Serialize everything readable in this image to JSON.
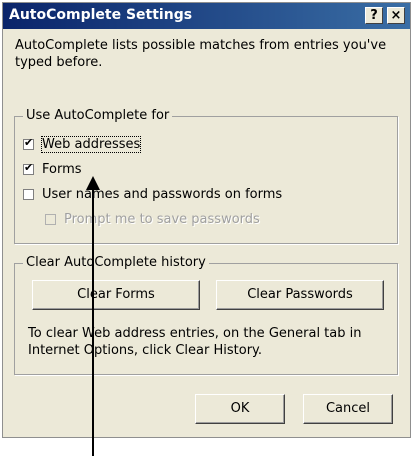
{
  "window": {
    "title": "AutoComplete Settings",
    "help_label": "?",
    "close_label": "×"
  },
  "description": "AutoComplete lists possible matches from entries you've typed before.",
  "use_group": {
    "label": "Use AutoComplete for",
    "options": [
      {
        "label": "Web addresses",
        "checked": true,
        "enabled": true
      },
      {
        "label": "Forms",
        "checked": true,
        "enabled": true
      },
      {
        "label": "User names and passwords on forms",
        "checked": false,
        "enabled": true
      },
      {
        "label": "Prompt me to save passwords",
        "checked": false,
        "enabled": false
      }
    ]
  },
  "history_group": {
    "label": "Clear AutoComplete history",
    "clear_forms_label": "Clear Forms",
    "clear_passwords_label": "Clear Passwords",
    "note": "To clear Web address entries, on the General tab in Internet Options, click Clear History."
  },
  "buttons": {
    "ok_label": "OK",
    "cancel_label": "Cancel"
  }
}
